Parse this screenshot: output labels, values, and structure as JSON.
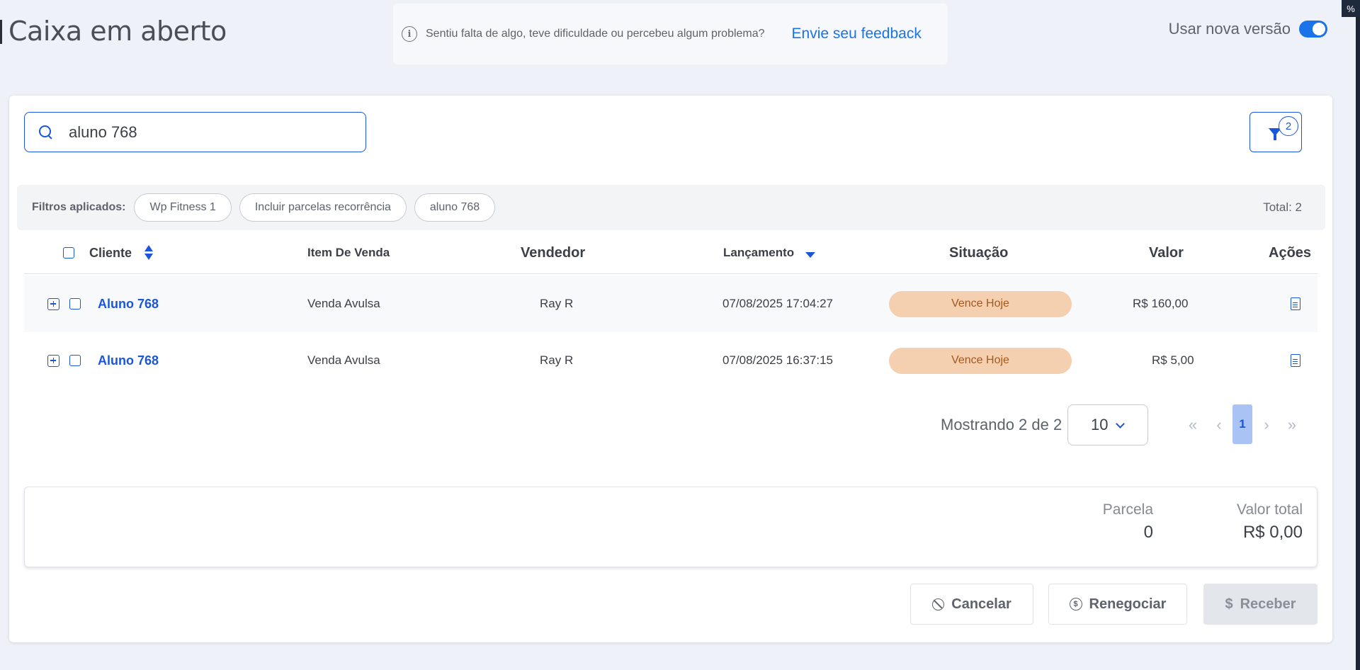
{
  "header": {
    "title": "Caixa em aberto",
    "feedback_text": "Sentiu falta de algo, teve dificuldade ou percebeu algum problema?",
    "feedback_link": "Envie seu feedback",
    "new_version_label": "Usar nova versão",
    "new_version_enabled": true,
    "corner_tag": "%"
  },
  "search": {
    "value": "aluno 768",
    "placeholder": ""
  },
  "filter_button": {
    "badge_count": "2"
  },
  "filters": {
    "label": "Filtros aplicados:",
    "chips": [
      "Wp Fitness 1",
      "Incluir parcelas recorrência",
      "aluno 768"
    ],
    "total": "Total: 2"
  },
  "table": {
    "columns": {
      "cliente": "Cliente",
      "item": "Item De Venda",
      "vendedor": "Vendedor",
      "lancamento": "Lançamento",
      "situacao": "Situação",
      "valor": "Valor",
      "acoes": "Ações"
    },
    "rows": [
      {
        "cliente": "Aluno 768",
        "item": "Venda Avulsa",
        "vendedor": "Ray R",
        "lancamento": "07/08/2025 17:04:27",
        "situacao": "Vence Hoje",
        "valor": "R$ 160,00"
      },
      {
        "cliente": "Aluno 768",
        "item": "Venda Avulsa",
        "vendedor": "Ray R",
        "lancamento": "07/08/2025 16:37:15",
        "situacao": "Vence Hoje",
        "valor": "R$ 5,00"
      }
    ]
  },
  "pagination": {
    "showing": "Mostrando 2 de 2",
    "page_size": "10",
    "first": "«",
    "prev": "‹",
    "current": "1",
    "next": "›",
    "last": "»"
  },
  "summary": {
    "parcela_label": "Parcela",
    "parcela_value": "0",
    "valor_total_label": "Valor total",
    "valor_total_value": "R$ 0,00"
  },
  "actions": {
    "cancelar": "Cancelar",
    "renegociar": "Renegociar",
    "receber": "Receber"
  },
  "colors": {
    "accent": "#1a56db",
    "link": "#1a73e8",
    "status_bg": "#f5d0b0",
    "status_text": "#a3581f"
  }
}
